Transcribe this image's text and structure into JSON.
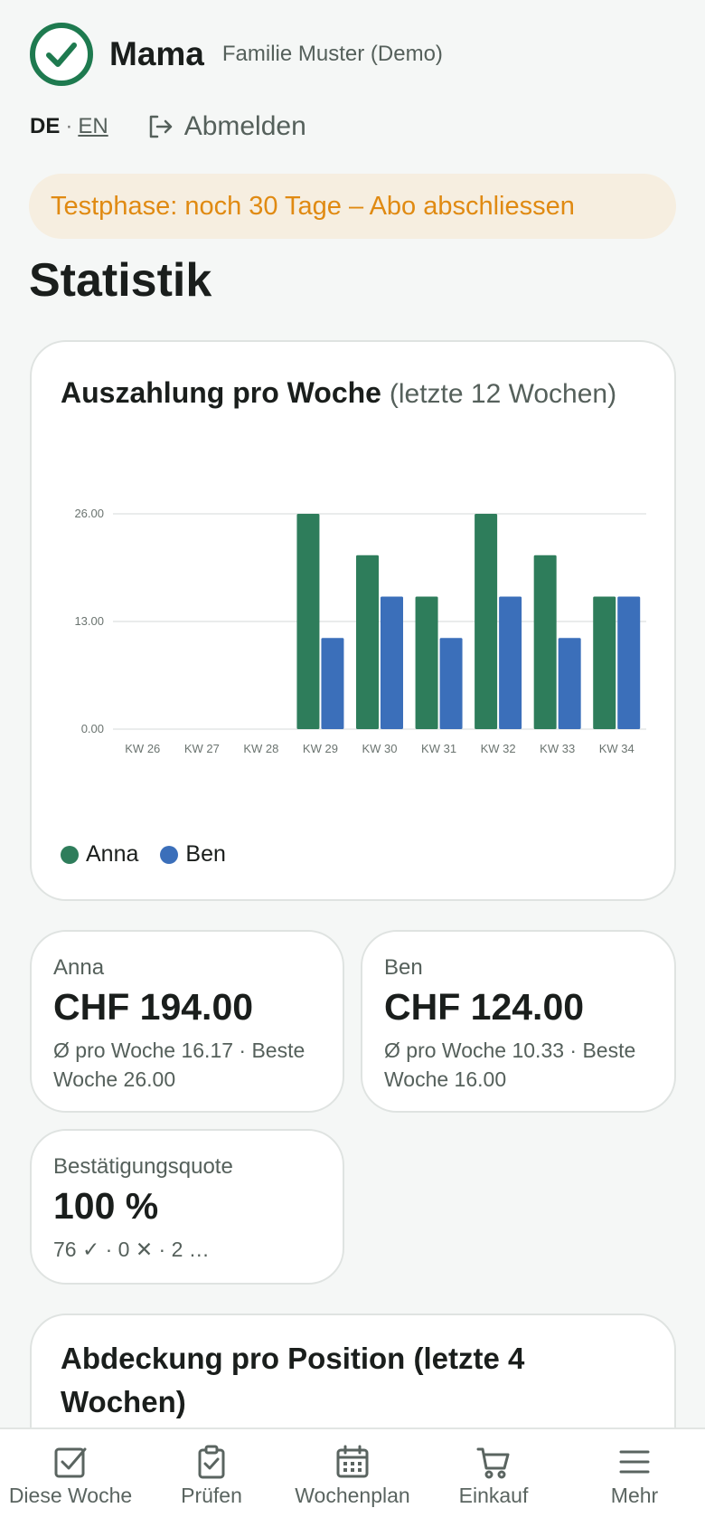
{
  "header": {
    "user_name": "Mama",
    "family": "Familie Muster (Demo)"
  },
  "lang": {
    "de": "DE",
    "sep": "·",
    "en": "EN"
  },
  "logout_label": "Abmelden",
  "trial_banner": "Testphase: noch 30 Tage – Abo abschliessen",
  "page_title": "Statistik",
  "chart": {
    "title": "Auszahlung pro Woche",
    "subtitle": "(letzte 12 Wochen)"
  },
  "chart_data": {
    "type": "bar",
    "categories": [
      "KW 26",
      "KW 27",
      "KW 28",
      "KW 29",
      "KW 30",
      "KW 31",
      "KW 32",
      "KW 33",
      "KW 34"
    ],
    "series": [
      {
        "name": "Anna",
        "color": "#2e7d5b",
        "values": [
          0,
          0,
          0,
          26,
          21,
          16,
          26,
          21,
          16
        ]
      },
      {
        "name": "Ben",
        "color": "#3b6fba",
        "values": [
          0,
          0,
          0,
          11,
          16,
          11,
          16,
          11,
          16
        ]
      }
    ],
    "ylim": [
      0,
      26
    ],
    "yticks": [
      "0.00",
      "13.00",
      "26.00"
    ],
    "ytick_values": [
      0,
      13,
      26
    ],
    "grid": true,
    "legend": "bottom-left"
  },
  "stats": {
    "anna": {
      "label": "Anna",
      "value": "CHF 194.00",
      "detail": "Ø pro Woche 16.17 · Beste Woche 26.00"
    },
    "ben": {
      "label": "Ben",
      "value": "CHF 124.00",
      "detail": "Ø pro Woche 10.33 · Beste Woche 16.00"
    },
    "quote": {
      "label": "Bestätigungsquote",
      "value": "100 %",
      "detail": "76 ✓ · 0 ✕ · 2 …"
    }
  },
  "coverage": {
    "title": "Abdeckung pro Position (letzte 4 Wochen)"
  },
  "nav": {
    "items": [
      {
        "label": "Diese Woche",
        "icon": "checkbox-icon"
      },
      {
        "label": "Prüfen",
        "icon": "clipboard-check-icon"
      },
      {
        "label": "Wochenplan",
        "icon": "calendar-icon"
      },
      {
        "label": "Einkauf",
        "icon": "cart-icon"
      },
      {
        "label": "Mehr",
        "icon": "menu-icon"
      }
    ]
  },
  "colors": {
    "brand": "#1e7a4f",
    "anna": "#2e7d5b",
    "ben": "#3b6fba",
    "trial_text": "#e08a12",
    "trial_bg": "#f6eee0"
  }
}
